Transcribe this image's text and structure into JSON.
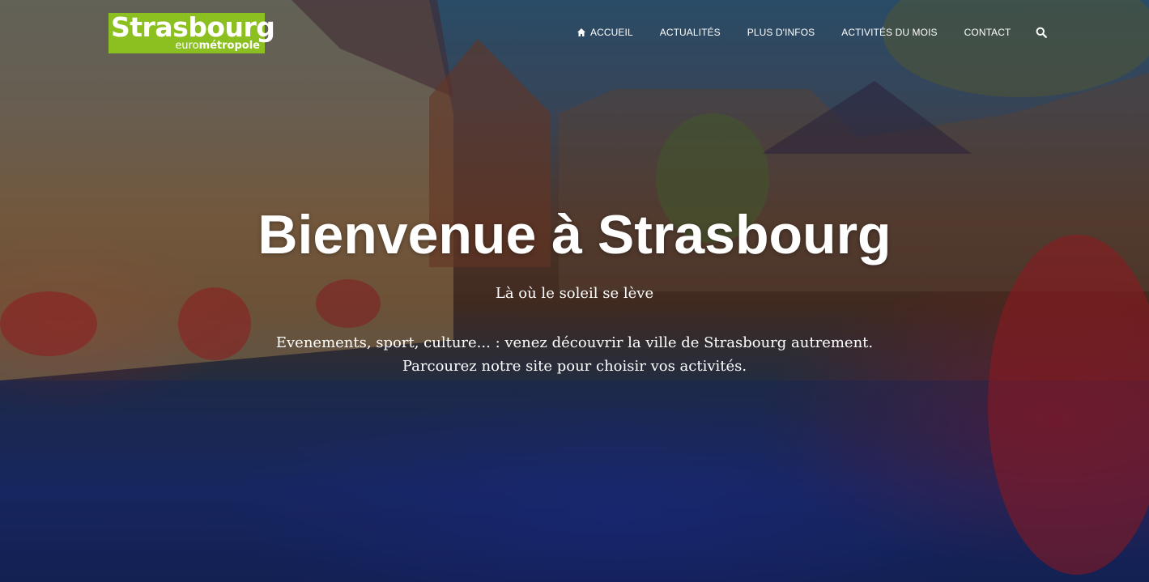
{
  "logo": {
    "line1": "Strasbourg",
    "line2_prefix": "euro",
    "line2_bold": "métropole",
    "color": "#8cc021"
  },
  "nav": {
    "items": [
      {
        "label": "Accueil",
        "icon": "home-icon"
      },
      {
        "label": "Actualités"
      },
      {
        "label": "Plus d'infos"
      },
      {
        "label": "Activités du mois"
      },
      {
        "label": "Contact"
      }
    ],
    "search_icon": "search-icon"
  },
  "hero": {
    "title": "Bienvenue à Strasbourg",
    "subtitle": "Là où le soleil se lève",
    "description_line1": "Evenements, sport, culture... : venez découvrir la ville de Strasbourg autrement.",
    "description_line2": "Parcourez notre site pour choisir vos activités."
  }
}
